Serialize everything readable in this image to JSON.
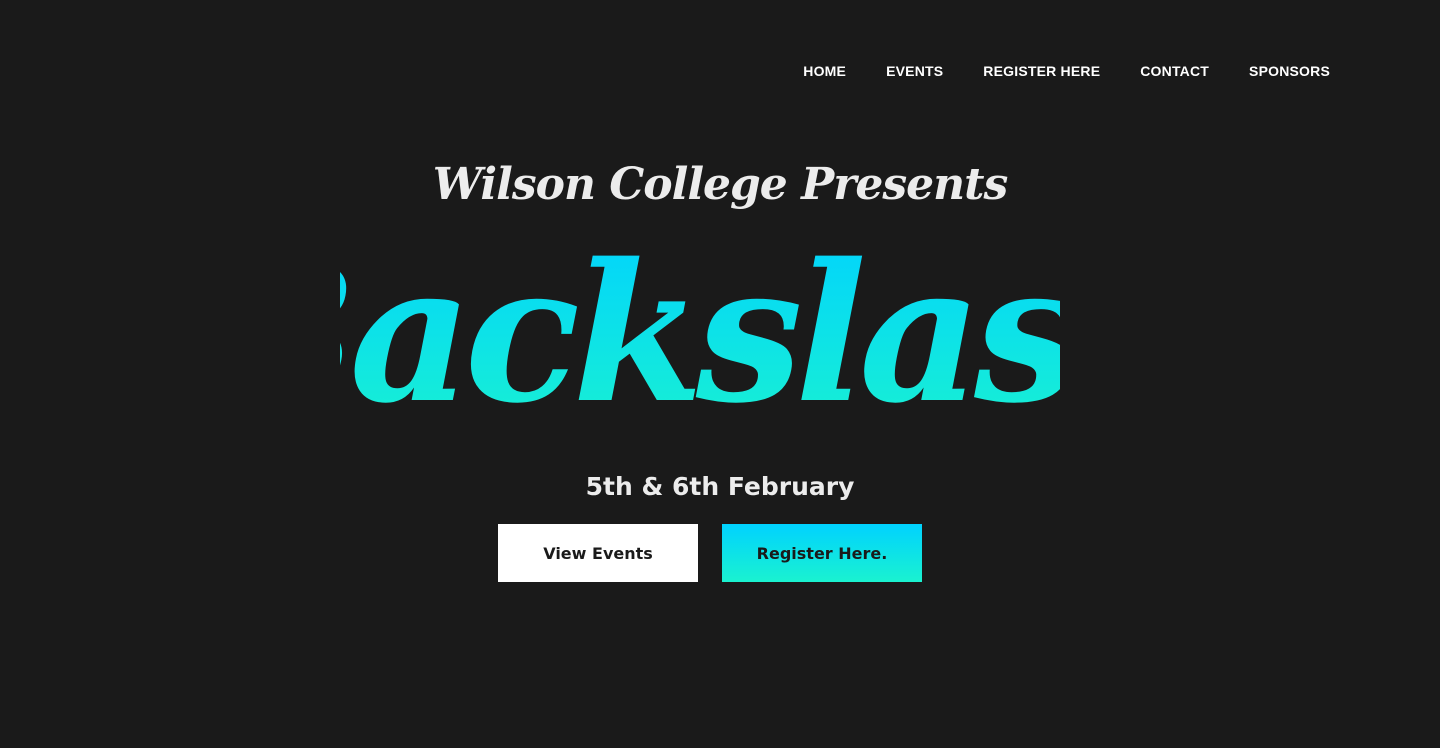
{
  "nav": {
    "items": [
      {
        "label": "HOME"
      },
      {
        "label": "EVENTS"
      },
      {
        "label": "REGISTER HERE"
      },
      {
        "label": "CONTACT"
      },
      {
        "label": "SPONSORS"
      }
    ]
  },
  "hero": {
    "presents": "Wilson College Presents",
    "title": "Backslash",
    "date": "5th & 6th February",
    "view_events_label": "View Events",
    "register_label": "Register Here."
  },
  "colors": {
    "background": "#1a1a1a",
    "gradient_top": "#00d2ff",
    "gradient_bottom": "#1af2d0",
    "text_light": "#ececec"
  }
}
